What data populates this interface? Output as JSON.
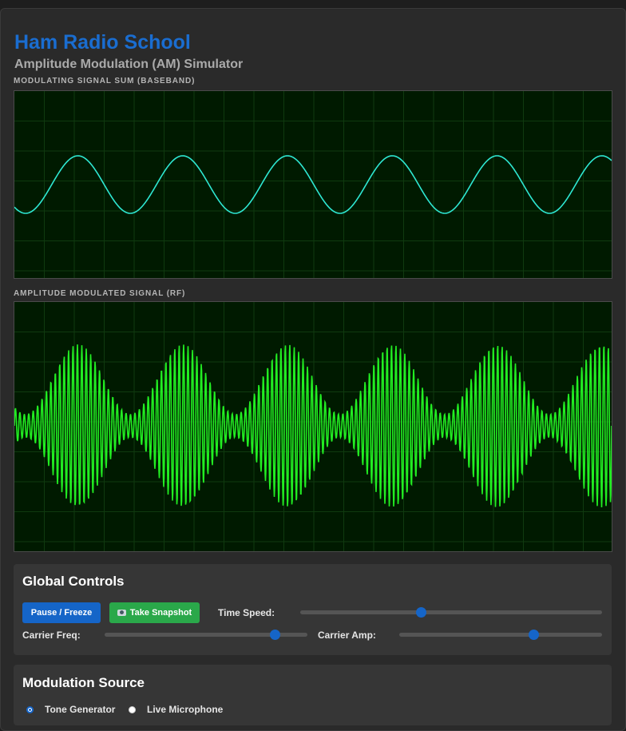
{
  "header": {
    "title": "Ham Radio School",
    "subtitle": "Amplitude Modulation (AM) Simulator"
  },
  "scopes": {
    "baseband_label": "Modulating Signal Sum (Baseband)",
    "rf_label": "Amplitude Modulated Signal (RF)",
    "colors": {
      "background": "#001a00",
      "grid": "#0f3a0f",
      "baseband_trace": "#2ee8d2",
      "rf_trace": "#22ee22"
    },
    "baseband_cycles": 5.7,
    "rf_carrier_cycles": 135,
    "modulation_depth": 0.75
  },
  "global_controls": {
    "heading": "Global Controls",
    "pause_label": "Pause / Freeze",
    "snapshot_label": "Take Snapshot",
    "snapshot_icon": "camera-icon",
    "time_speed_label": "Time Speed:",
    "time_speed_value": 0.4,
    "carrier_freq_label": "Carrier Freq:",
    "carrier_freq_value": 0.84,
    "carrier_amp_label": "Carrier Amp:",
    "carrier_amp_value": 0.66
  },
  "modulation_source": {
    "heading": "Modulation Source",
    "options": [
      {
        "label": "Tone Generator",
        "checked": true
      },
      {
        "label": "Live Microphone",
        "checked": false
      }
    ]
  },
  "accent_color": "#1565c8"
}
